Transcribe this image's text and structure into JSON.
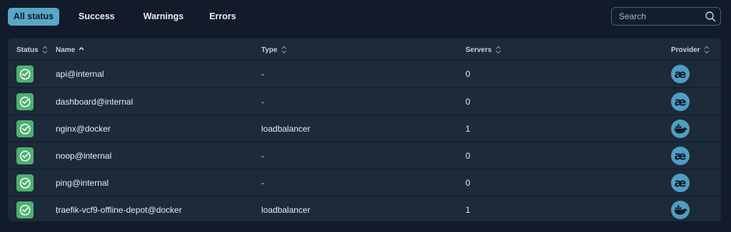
{
  "filters": {
    "all_label": "All status",
    "success_label": "Success",
    "warnings_label": "Warnings",
    "errors_label": "Errors",
    "active": "All status"
  },
  "search": {
    "placeholder": "Search",
    "value": ""
  },
  "table": {
    "headers": {
      "status": "Status",
      "name": "Name",
      "type": "Type",
      "servers": "Servers",
      "provider": "Provider"
    },
    "sort": {
      "column": "Name",
      "direction": "ascending"
    },
    "rows": [
      {
        "status": "success",
        "name": "api@internal",
        "type": "-",
        "servers": "0",
        "provider": "internal-icon"
      },
      {
        "status": "success",
        "name": "dashboard@internal",
        "type": "-",
        "servers": "0",
        "provider": "internal-icon"
      },
      {
        "status": "success",
        "name": "nginx@docker",
        "type": "loadbalancer",
        "servers": "1",
        "provider": "docker-icon"
      },
      {
        "status": "success",
        "name": "noop@internal",
        "type": "-",
        "servers": "0",
        "provider": "internal-icon"
      },
      {
        "status": "success",
        "name": "ping@internal",
        "type": "-",
        "servers": "0",
        "provider": "internal-icon"
      },
      {
        "status": "success",
        "name": "traefik-vcf9-offline-depot@docker",
        "type": "loadbalancer",
        "servers": "1",
        "provider": "docker-icon"
      }
    ]
  },
  "colors": {
    "background": "#111b29",
    "panel": "#1c2a3a",
    "accent": "#5aa6c7",
    "success": "#4fb070",
    "provider": "#4f9ec2"
  }
}
